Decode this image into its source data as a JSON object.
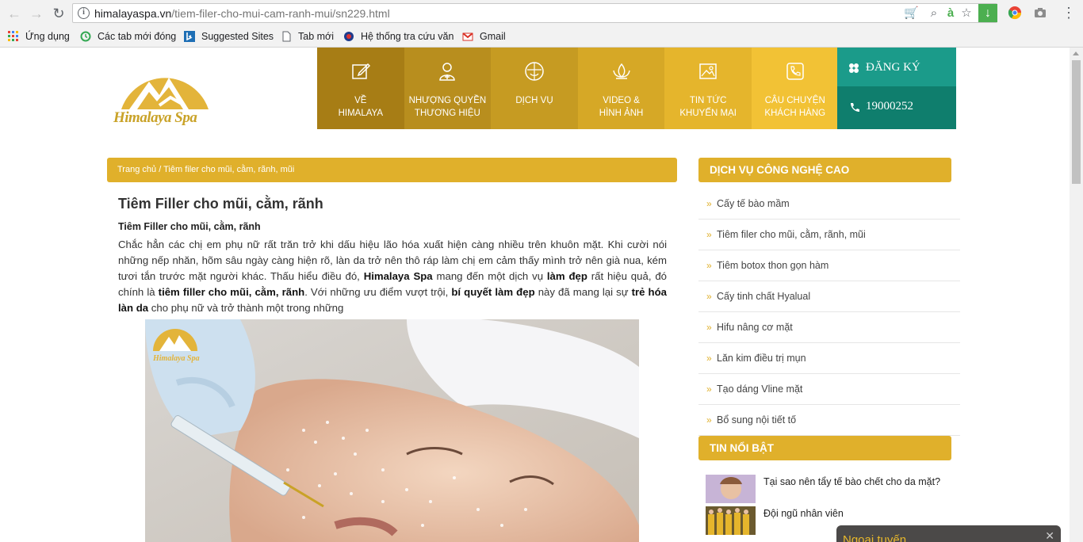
{
  "browser": {
    "url_domain": "himalayaspa.vn",
    "url_path": "/tiem-filer-cho-mui-cam-ranh-mui/sn229.html",
    "bookmarks": [
      "Ứng dụng",
      "Các tab mới đóng",
      "Suggested Sites",
      "Tab mới",
      "Hệ thống tra cứu văn",
      "Gmail"
    ]
  },
  "site": {
    "logo_text": "Himalaya Spa",
    "nav": [
      {
        "line1": "VỀ",
        "line2": "HIMALAYA",
        "color": "#a77d15",
        "icon": "edit-icon"
      },
      {
        "line1": "NHƯỢNG QUYỀN",
        "line2": "THƯƠNG HIỆU",
        "color": "#b88e1e",
        "icon": "person-icon"
      },
      {
        "line1": "DỊCH VỤ",
        "line2": "",
        "color": "#c69b22",
        "icon": "face-icon"
      },
      {
        "line1": "VIDEO &",
        "line2": "HÌNH ẢNH",
        "color": "#d6a826",
        "icon": "lotus-icon"
      },
      {
        "line1": "TIN TỨC",
        "line2": "KHUYẾN MẠI",
        "color": "#e5b52c",
        "icon": "image-icon"
      },
      {
        "line1": "CÂU CHUYỆN",
        "line2": "KHÁCH HÀNG",
        "color": "#f2c235",
        "icon": "phone-icon"
      }
    ],
    "register_label": "ĐĂNG KÝ",
    "hotline": "19000252"
  },
  "breadcrumb": {
    "home": "Trang chủ",
    "separator": "/",
    "current": "Tiêm filer cho mũi, cằm, rãnh, mũi"
  },
  "article": {
    "title": "Tiêm Filler cho mũi, cằm, rãnh",
    "subtitle": "Tiêm Filler cho mũi, cằm, rãnh",
    "p1": "Chắc hẳn các chị em phụ nữ rất trăn trở khi dấu hiệu lão hóa xuất hiện càng nhiều trên khuôn mặt. Khi cười nói những nếp nhăn, hõm sâu ngày càng hiện rõ, làn da trở nên thô ráp làm chị em cảm thấy mình trở nên già nua, kém tươi tắn trước mặt người khác. Thấu hiểu điều đó, ",
    "b1": "Himalaya Spa",
    "p2": " mang đến một dịch vụ ",
    "b2": "làm đẹp",
    "p3": " rất hiệu quả, đó chính là ",
    "b3": "tiêm filler cho mũi, cằm, rãnh",
    "p4": ". Với những ưu điểm vượt trội, ",
    "b4": "bí quyết làm đẹp",
    "p5": " này đã mang lại sự ",
    "b5": "trẻ hóa làn da",
    "p6": " cho phụ nữ và trở thành một trong những",
    "photo_logo": "Himalaya Spa"
  },
  "sidebar": {
    "services_title": "DỊCH VỤ CÔNG NGHỆ CAO",
    "services": [
      "Cấy tế bào mầm",
      "Tiêm filer cho mũi, cằm, rãnh, mũi",
      "Tiêm botox thon gọn hàm",
      "Cấy tinh chất Hyalual",
      "Hifu nâng cơ mặt",
      "Lăn kim điều trị mụn",
      "Tạo dáng Vline mặt",
      "Bổ sung nội tiết tố"
    ],
    "news_title": "TIN NỔI BẬT",
    "news": [
      "Tại sao nên tẩy tế bào chết cho da mặt?",
      "Đội ngũ nhân viên"
    ]
  },
  "chat": {
    "label": "Ngoại tuyến"
  },
  "colors": {
    "gold": "#e0b02b",
    "teal": "#1b9b8a",
    "teal_dark": "#0f7e6d"
  }
}
